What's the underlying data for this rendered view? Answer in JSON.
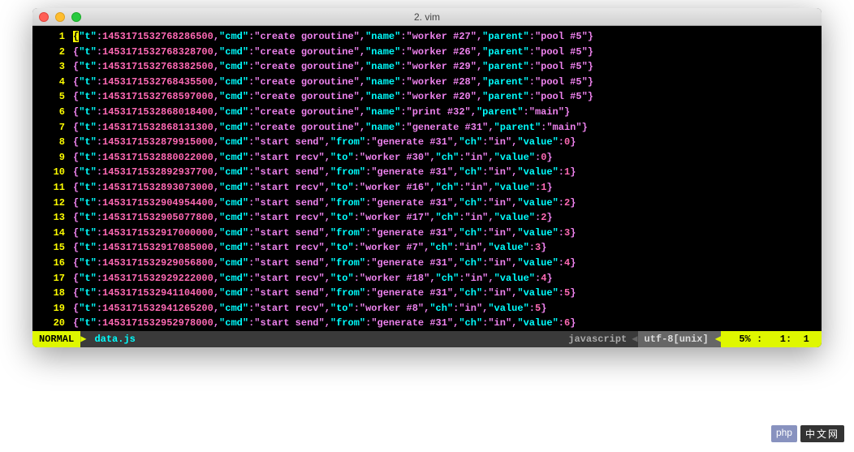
{
  "window": {
    "title": "2. vim"
  },
  "lines": [
    {
      "n": 1,
      "entry": {
        "t": 1453171532768286484,
        "cmd": "create goroutine",
        "name": "worker #27",
        "parent": "pool #5"
      }
    },
    {
      "n": 2,
      "entry": {
        "t": 1453171532768328577,
        "cmd": "create goroutine",
        "name": "worker #26",
        "parent": "pool #5"
      }
    },
    {
      "n": 3,
      "entry": {
        "t": 1453171532768382492,
        "cmd": "create goroutine",
        "name": "worker #29",
        "parent": "pool #5"
      }
    },
    {
      "n": 4,
      "entry": {
        "t": 1453171532768435406,
        "cmd": "create goroutine",
        "name": "worker #28",
        "parent": "pool #5"
      }
    },
    {
      "n": 5,
      "entry": {
        "t": 1453171532768596996,
        "cmd": "create goroutine",
        "name": "worker #20",
        "parent": "pool #5"
      }
    },
    {
      "n": 6,
      "entry": {
        "t": 1453171532868018479,
        "cmd": "create goroutine",
        "name": "print #32",
        "parent": "main"
      }
    },
    {
      "n": 7,
      "entry": {
        "t": 1453171532868131248,
        "cmd": "create goroutine",
        "name": "generate #31",
        "parent": "main"
      }
    },
    {
      "n": 8,
      "entry": {
        "t": 1453171532879915073,
        "cmd": "start send",
        "from": "generate #31",
        "ch": "in",
        "value": 0
      }
    },
    {
      "n": 9,
      "entry": {
        "t": 1453171532880021908,
        "cmd": "start recv",
        "to": "worker #30",
        "ch": "in",
        "value": 0
      }
    },
    {
      "n": 10,
      "entry": {
        "t": 1453171532892937700,
        "cmd": "start send",
        "from": "generate #31",
        "ch": "in",
        "value": 1
      }
    },
    {
      "n": 11,
      "entry": {
        "t": 1453171532893072787,
        "cmd": "start recv",
        "to": "worker #16",
        "ch": "in",
        "value": 1
      }
    },
    {
      "n": 12,
      "entry": {
        "t": 1453171532904954369,
        "cmd": "start send",
        "from": "generate #31",
        "ch": "in",
        "value": 2
      }
    },
    {
      "n": 13,
      "entry": {
        "t": 1453171532905077725,
        "cmd": "start recv",
        "to": "worker #17",
        "ch": "in",
        "value": 2
      }
    },
    {
      "n": 14,
      "entry": {
        "t": 1453171532916999950,
        "cmd": "start send",
        "from": "generate #31",
        "ch": "in",
        "value": 3
      }
    },
    {
      "n": 15,
      "entry": {
        "t": 1453171532917084835,
        "cmd": "start recv",
        "to": "worker #7",
        "ch": "in",
        "value": 3
      }
    },
    {
      "n": 16,
      "entry": {
        "t": 1453171532929056797,
        "cmd": "start send",
        "from": "generate #31",
        "ch": "in",
        "value": 4
      }
    },
    {
      "n": 17,
      "entry": {
        "t": 1453171532929221817,
        "cmd": "start recv",
        "to": "worker #18",
        "ch": "in",
        "value": 4
      }
    },
    {
      "n": 18,
      "entry": {
        "t": 1453171532941104211,
        "cmd": "start send",
        "from": "generate #31",
        "ch": "in",
        "value": 5
      }
    },
    {
      "n": 19,
      "entry": {
        "t": 1453171532941265219,
        "cmd": "start recv",
        "to": "worker #8",
        "ch": "in",
        "value": 5
      }
    },
    {
      "n": 20,
      "entry": {
        "t": 1453171532952977981,
        "cmd": "start send",
        "from": "generate #31",
        "ch": "in",
        "value": 6
      }
    }
  ],
  "status": {
    "mode": "NORMAL",
    "filename": "data.js",
    "filetype": "javascript",
    "encoding": "utf-8[unix]",
    "percent": "5%",
    "line": "1",
    "col": "1"
  },
  "badge": {
    "php": "php",
    "cn": "中文网"
  }
}
